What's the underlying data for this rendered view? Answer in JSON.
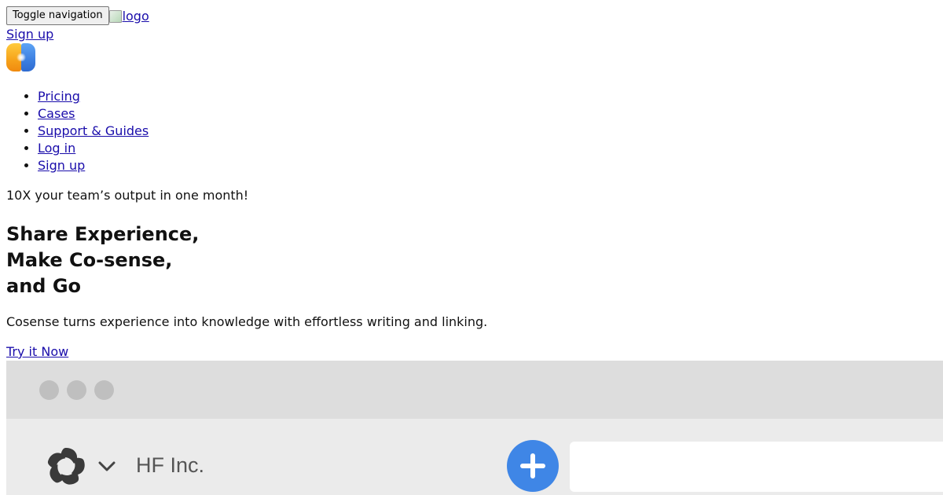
{
  "header": {
    "toggle_label": "Toggle navigation",
    "logo_alt": "logo",
    "signup_label": "Sign up"
  },
  "nav": {
    "items": [
      {
        "label": "Pricing"
      },
      {
        "label": "Cases"
      },
      {
        "label": "Support & Guides"
      },
      {
        "label": "Log in"
      },
      {
        "label": "Sign up"
      }
    ]
  },
  "hero": {
    "tagline": "10X your team’s output in one month!",
    "title_lines": [
      "Share Experience,",
      "Make Co-sense,",
      "and Go"
    ],
    "description": "Cosense turns experience into knowledge with effortless writing and linking.",
    "cta_label": "Try it Now"
  },
  "mock_app": {
    "org_name": "HF Inc."
  },
  "colors": {
    "link": "#1a0dab",
    "brand_orange": "#f6a21a",
    "brand_blue": "#3d7fe0",
    "add_button": "#3f86e6"
  },
  "icons": [
    "broken-image-icon",
    "cosense-logo-icon",
    "helix-logo-icon",
    "chevron-down-icon",
    "plus-icon"
  ]
}
